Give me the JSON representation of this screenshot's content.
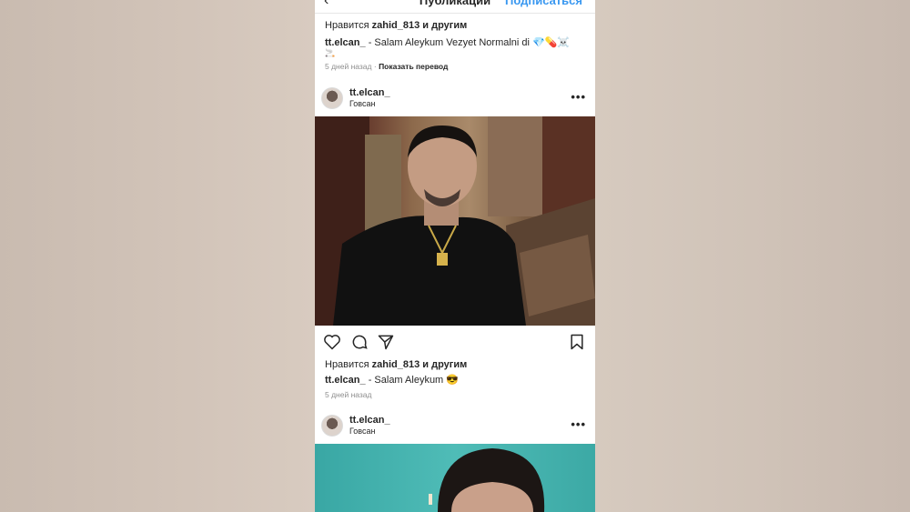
{
  "header": {
    "title": "Публикации",
    "follow_label": "Подписаться",
    "back_icon": "chevron-left-icon"
  },
  "previous_post": {
    "likes_prefix": "Нравится",
    "likes_user": "zahid_813",
    "likes_suffix": "и другим",
    "caption_user": "tt.elcan_",
    "caption_text": " - Salam Aleykum Vezyet Normalni di 💎💊☠️",
    "caption_overflow": "🚬",
    "time": "5 дней назад",
    "translate": "Показать перевод"
  },
  "post": {
    "username": "tt.elcan_",
    "location": "Говсан",
    "more_icon": "more-dots-icon",
    "likes_prefix": "Нравится",
    "likes_user": "zahid_813",
    "likes_suffix": "и другим",
    "caption_user": "tt.elcan_",
    "caption_text": " - Salam Aleykum 😎",
    "time": "5 дней назад"
  },
  "next_post": {
    "username": "tt.elcan_",
    "location": "Говсан"
  },
  "colors": {
    "link": "#3897f0",
    "text": "#262626",
    "muted": "#8e8e8e",
    "background": "#cdbfb4"
  }
}
